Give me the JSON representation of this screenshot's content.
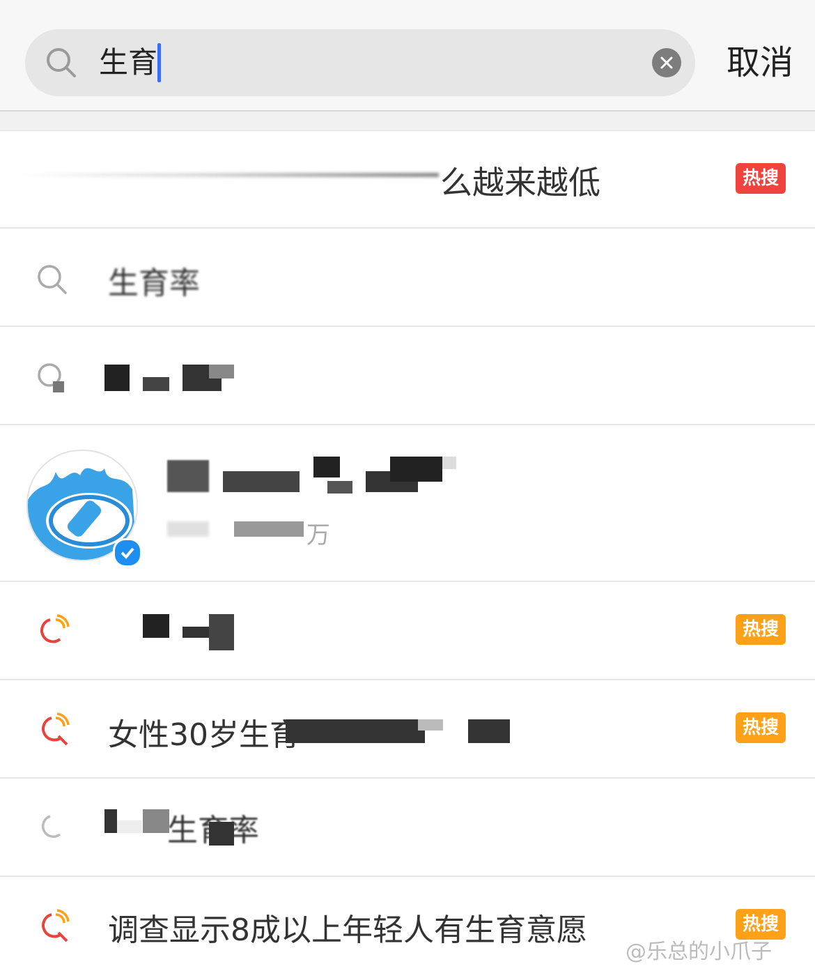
{
  "search": {
    "query": "生育",
    "cancel_label": "取消"
  },
  "suggestions": [
    {
      "text": "么越来越低",
      "badge": "热搜",
      "badge_color": "#f0433e",
      "icon": "none"
    },
    {
      "text": "生育率",
      "badge": "",
      "icon": "search-icon"
    },
    {
      "text": "",
      "badge": "",
      "icon": "search-icon"
    },
    {
      "text": "",
      "badge": "热搜",
      "badge_color": "#ffa019",
      "icon": "hot-search-icon"
    },
    {
      "text": "女性30岁生育",
      "badge": "热搜",
      "badge_color": "#ffa019",
      "icon": "hot-search-icon"
    },
    {
      "text": "生育率",
      "badge": "",
      "icon": "search-icon"
    },
    {
      "text": "调查显示8成以上年轻人有生育意愿",
      "badge": "热搜",
      "badge_color": "#ffa019",
      "icon": "hot-search-icon"
    }
  ],
  "user_result": {
    "name": "",
    "meta": "万",
    "verified": true
  },
  "watermark": "@乐总的小爪子"
}
